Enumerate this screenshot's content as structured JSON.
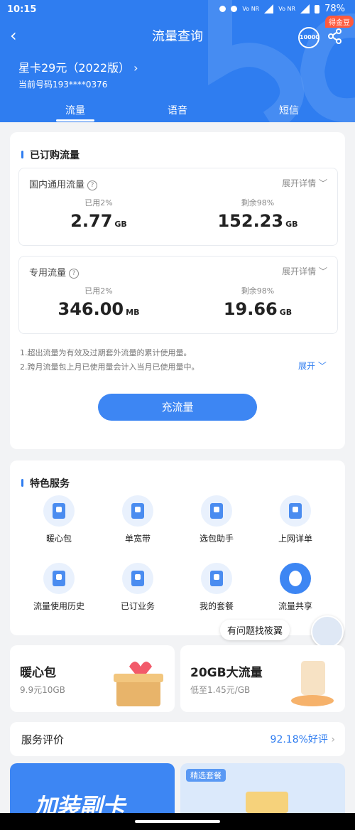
{
  "status": {
    "time": "10:15",
    "battery": "78%",
    "volte1": "Vo NR",
    "volte2": "Vo NR"
  },
  "nav": {
    "title": "流量查询",
    "badge": "得金豆"
  },
  "plan": {
    "name": "星卡29元（2022版）",
    "phone": "当前号码193****0376"
  },
  "tabs": [
    {
      "label": "流量"
    },
    {
      "label": "语音"
    },
    {
      "label": "短信"
    }
  ],
  "subscribed": {
    "title": "已订购流量",
    "domestic": {
      "name": "国内通用流量",
      "detail": "展开详情",
      "used_label": "已用2%",
      "used": "2.77",
      "used_unit": "GB",
      "remain_label": "剩余98%",
      "remain": "152.23",
      "remain_unit": "GB"
    },
    "special": {
      "name": "专用流量",
      "detail": "展开详情",
      "used_label": "已用2%",
      "used": "346.00",
      "used_unit": "MB",
      "remain_label": "剩余98%",
      "remain": "19.66",
      "remain_unit": "GB"
    },
    "note1": "1.超出流量为有效及过期套外流量的累计使用量。",
    "note2": "2.跨月流量包上月已使用量会计入当月已使用量中。",
    "expand": "展开",
    "button": "充流量"
  },
  "services": {
    "title": "特色服务",
    "items": [
      {
        "label": "暖心包",
        "icon": "gift-icon"
      },
      {
        "label": "单宽带",
        "icon": "broadband-icon"
      },
      {
        "label": "选包助手",
        "icon": "assistant-icon"
      },
      {
        "label": "上网详单",
        "icon": "bill-icon"
      },
      {
        "label": "流量使用历史",
        "icon": "history-icon"
      },
      {
        "label": "已订业务",
        "icon": "subscribed-icon"
      },
      {
        "label": "我的套餐",
        "icon": "package-icon"
      },
      {
        "label": "流量共享",
        "icon": "share-flow-icon"
      }
    ]
  },
  "helper": "有问题找筱翼",
  "promos": [
    {
      "title": "暖心包",
      "sub": "9.9元10GB"
    },
    {
      "title": "20GB大流量",
      "sub": "低至1.45元/GB"
    }
  ],
  "rating": {
    "label": "服务评价",
    "value": "92.18%好评"
  },
  "banners": [
    {
      "text": "加装副卡"
    },
    {
      "tag": "精选套餐"
    }
  ],
  "colors": {
    "primary": "#2f7df0",
    "background": "#f2f3f5"
  }
}
